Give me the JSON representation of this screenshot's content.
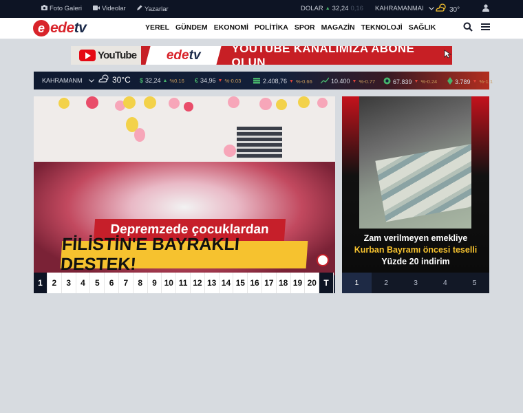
{
  "topbar": {
    "photo_gallery": "Foto Galeri",
    "videos": "Videolar",
    "authors": "Yazarlar",
    "currency_label": "DOLAR",
    "currency_value": "32,24",
    "currency_change": "0,16",
    "city": "KAHRAMANMAI",
    "temperature": "30°"
  },
  "nav": {
    "logo_e": "e",
    "logo_rest": "ede",
    "logo_tv": "tv",
    "menu": [
      "YEREL",
      "GÜNDEM",
      "EKONOMİ",
      "POLİTİKA",
      "SPOR",
      "MAGAZİN",
      "TEKNOLOJİ",
      "SAĞLIK"
    ]
  },
  "banner": {
    "youtube": "YouTube",
    "logo_rest": "ede",
    "logo_tv": "tv",
    "text": "YOUTUBE KANALIMIZA ABONE OLUN"
  },
  "ticker": {
    "city": "KAHRAMANM",
    "temp": "30°C",
    "items": [
      {
        "value": "32,24",
        "change": "%0.16",
        "dir": "up"
      },
      {
        "value": "34,96",
        "change": "%-0.03",
        "dir": "down"
      },
      {
        "value": "2.408,76",
        "change": "%-0.66",
        "dir": "down"
      },
      {
        "value": "10.400",
        "change": "%-0.77",
        "dir": "down"
      },
      {
        "value": "67.839",
        "change": "%-0.24",
        "dir": "down"
      },
      {
        "value": "3.789",
        "change": "%-1.1",
        "dir": "down"
      }
    ]
  },
  "slider": {
    "headline_top": "Depremzede çocuklardan",
    "headline_bottom": "FİLİSTİN'E BAYRAKLI DESTEK!",
    "pages": [
      "1",
      "2",
      "3",
      "4",
      "5",
      "6",
      "7",
      "8",
      "9",
      "10",
      "11",
      "12",
      "13",
      "14",
      "15",
      "16",
      "17",
      "18",
      "19",
      "20"
    ],
    "active_page": "1",
    "last": "T"
  },
  "side": {
    "line1": "Zam verilmeyen emekliye",
    "line2": "Kurban Bayramı öncesi teselli",
    "line3": "Yüzde 20 indirim",
    "pages": [
      "1",
      "2",
      "3",
      "4",
      "5"
    ],
    "active_page": "1"
  }
}
